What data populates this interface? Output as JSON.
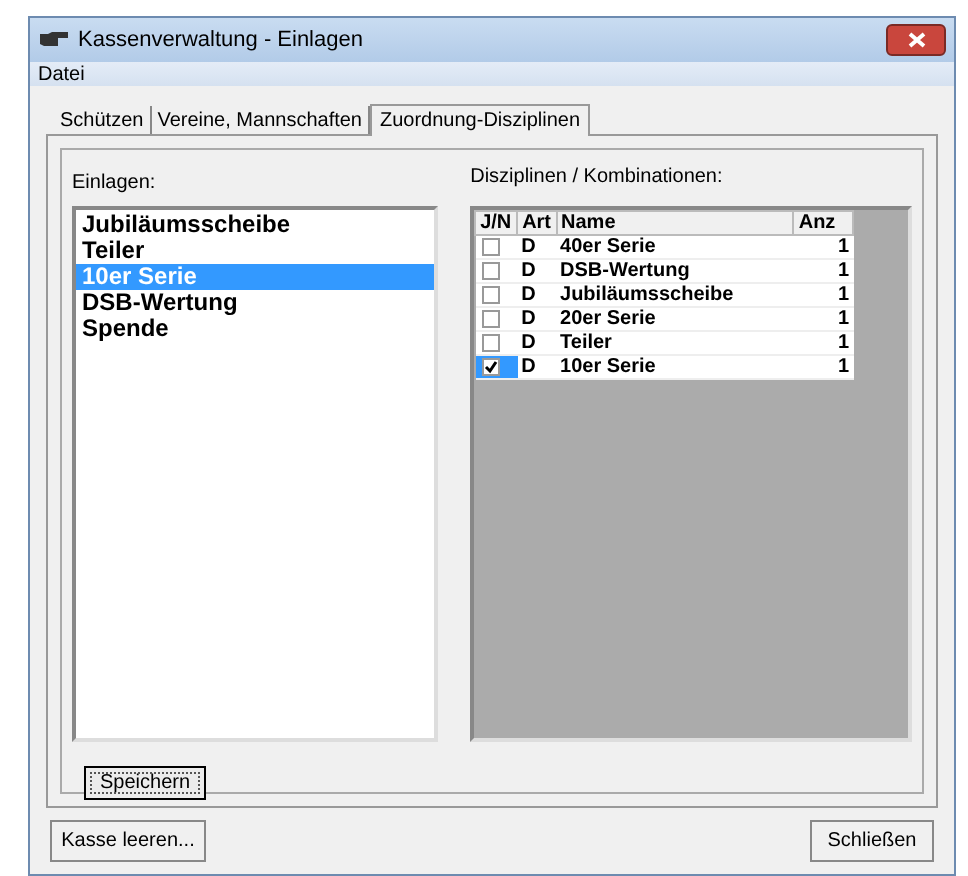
{
  "window": {
    "title": "Kassenverwaltung - Einlagen"
  },
  "menu": [
    "Datei"
  ],
  "tabs": [
    {
      "label": "Schützen",
      "selected": false
    },
    {
      "label": "Vereine, Mannschaften",
      "selected": false
    },
    {
      "label": "Zuordnung-Disziplinen",
      "selected": true
    }
  ],
  "einlagen": {
    "label": "Einlagen:",
    "items": [
      {
        "label": "Jubiläumsscheibe",
        "selected": false
      },
      {
        "label": "Teiler",
        "selected": false
      },
      {
        "label": "10er Serie",
        "selected": true
      },
      {
        "label": "DSB-Wertung",
        "selected": false
      },
      {
        "label": "Spende",
        "selected": false
      }
    ]
  },
  "disziplinen": {
    "label": "Disziplinen / Kombinationen:",
    "columns": [
      "J/N",
      "Art",
      "Name",
      "Anz"
    ],
    "rows": [
      {
        "checked": false,
        "art": "D",
        "name": "40er Serie",
        "anz": "1"
      },
      {
        "checked": false,
        "art": "D",
        "name": "DSB-Wertung",
        "anz": "1"
      },
      {
        "checked": false,
        "art": "D",
        "name": "Jubiläumsscheibe",
        "anz": "1"
      },
      {
        "checked": false,
        "art": "D",
        "name": "20er Serie",
        "anz": "1"
      },
      {
        "checked": false,
        "art": "D",
        "name": "Teiler",
        "anz": "1"
      },
      {
        "checked": true,
        "art": "D",
        "name": "10er Serie",
        "anz": "1"
      }
    ]
  },
  "save_button": "Speichern",
  "buttons": [
    "Kasse leeren...",
    "Schließen"
  ]
}
